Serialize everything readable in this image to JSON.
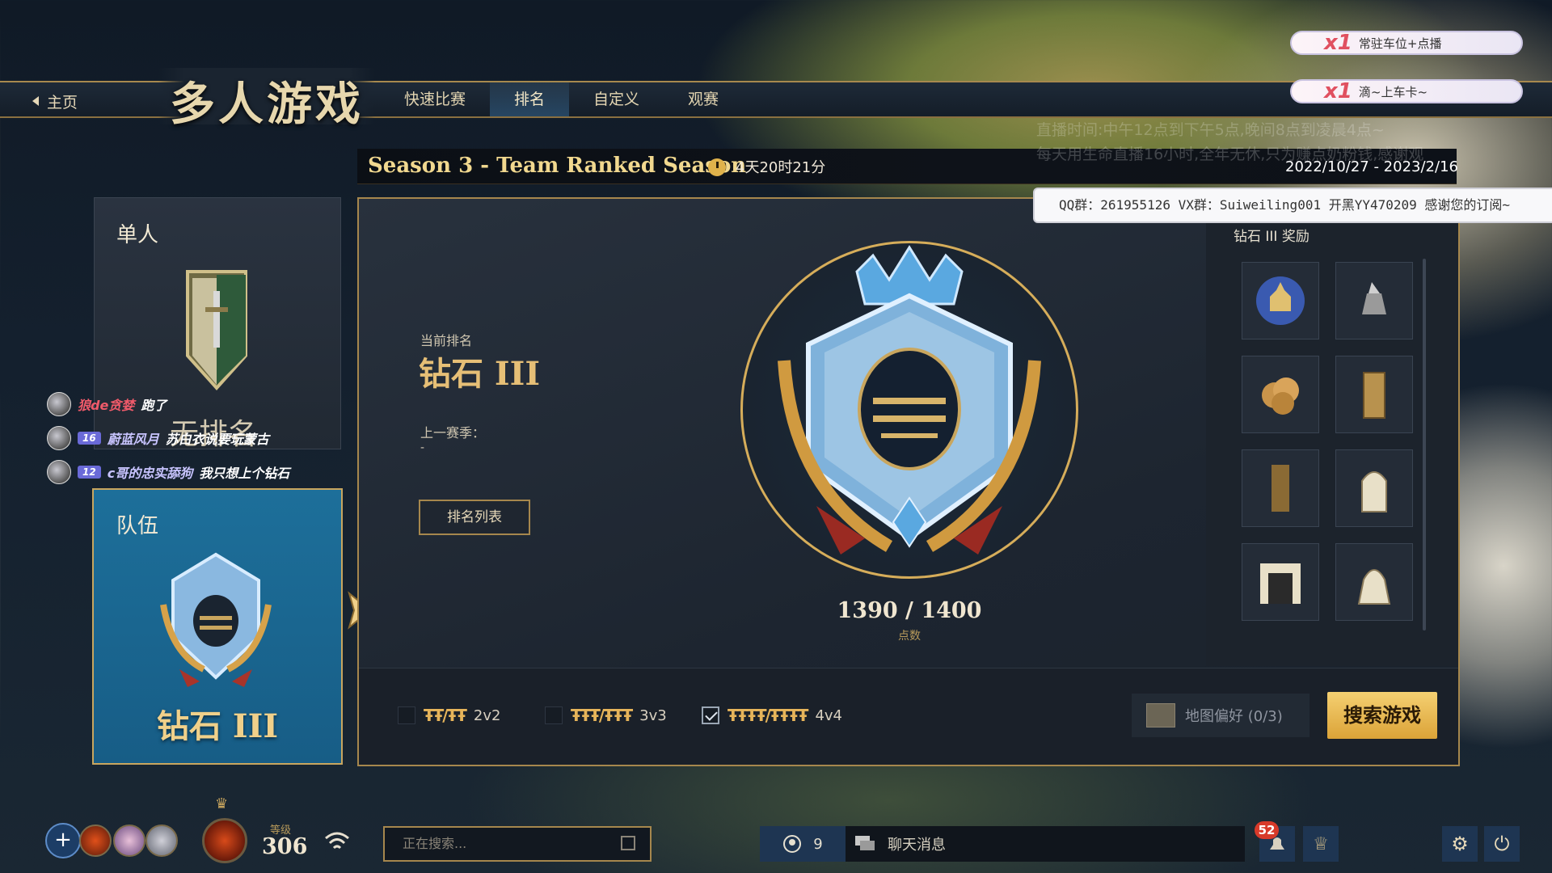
{
  "nav": {
    "home_label": "主页",
    "page_title": "多人游戏",
    "tabs": [
      "快速比赛",
      "排名",
      "自定义",
      "观赛"
    ],
    "active_tab": "排名"
  },
  "season": {
    "title": "Season 3 - Team Ranked Season",
    "time_left": "4天20时21分",
    "dates": "2022/10/27 - 2023/2/16"
  },
  "solo": {
    "label": "单人",
    "rank": "无排名"
  },
  "team": {
    "label": "队伍",
    "rank": "钻石 III"
  },
  "current": {
    "rank_label": "当前排名",
    "rank_value": "钻石 III",
    "prev_season_label": "上一赛季：",
    "prev_season_value": "-",
    "rank_list_button": "排名列表",
    "points": "1390 / 1400",
    "points_label": "点数"
  },
  "rewards": {
    "title": "钻石 III 奖励",
    "items": [
      "palace-globe-icon",
      "ship-figure-icon",
      "cloud-emblem-icon",
      "stone-pillar-icon",
      "banner-gate-icon",
      "arched-door-icon",
      "portcullis-gate-icon",
      "statue-fountain-icon"
    ]
  },
  "modes": [
    {
      "label": "2v2",
      "checked": false
    },
    {
      "label": "3v3",
      "checked": false
    },
    {
      "label": "4v4",
      "checked": true
    }
  ],
  "map_pref": "地图偏好 (0/3)",
  "search_button": "搜索游戏",
  "bottom": {
    "level_label": "等级",
    "level_value": "306",
    "search_status": "正在搜索...",
    "online_count": "9",
    "chat_label": "聊天消息",
    "notif_count": "52"
  },
  "chat_overlay": [
    {
      "name": "狼de贪婪",
      "badge": "",
      "text": "跑了"
    },
    {
      "name": "蔚蓝风月",
      "badge": "16",
      "text": "苏白衣说要玩蒙古"
    },
    {
      "name": "c哥的忠实舔狗",
      "badge": "12",
      "text": "我只想上个钻石"
    }
  ],
  "stream_overlay": {
    "gifts": [
      {
        "count": "x1",
        "text": "常驻车位+点播"
      },
      {
        "count": "x1",
        "text": "滴~上车卡~"
      }
    ],
    "notice1": "直播时间:中午12点到下午5点,晚间8点到凌晨4点~",
    "notice2": "每天用生命直播16小时,全年无休,只为赚点奶粉钱,感谢观",
    "qq_line": "QQ群：261955126 VX群：Suiweiling001 开黑YY470209 感谢您的订阅~"
  },
  "colors": {
    "gold": "#a6874d",
    "team_card": "#1d6f9a",
    "search_button": "#e8b84e",
    "rank_text": "#e6bf76"
  }
}
